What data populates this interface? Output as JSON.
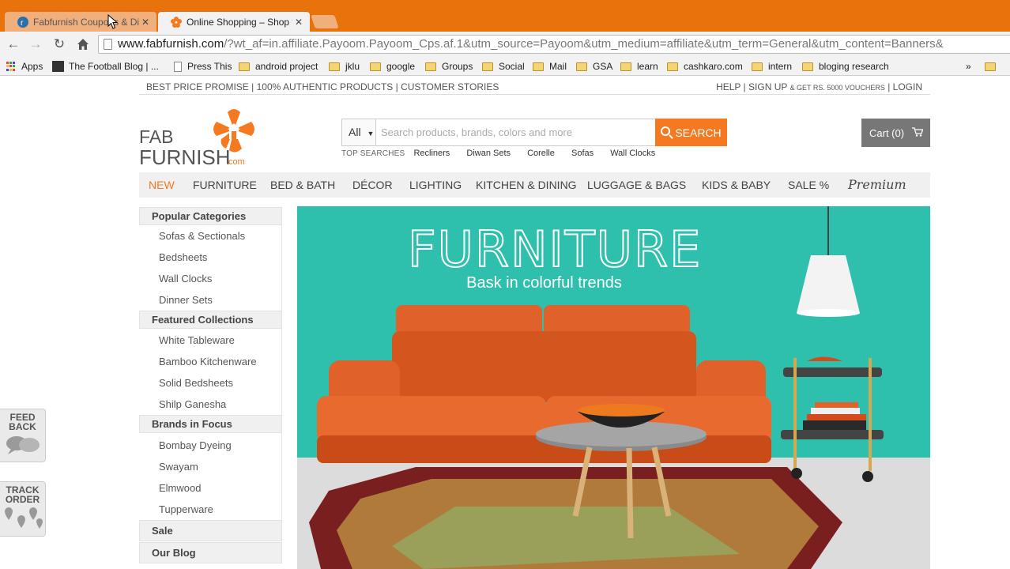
{
  "browser": {
    "tabs": [
      {
        "title": "Fabfurnish Coupons & Discount",
        "active": false
      },
      {
        "title": "Online Shopping – Shop for",
        "active": true
      }
    ],
    "url_host": "www.fabfurnish.com",
    "url_path": "/?wt_af=in.affiliate.Payoom.Payoom_Cps.af.1&utm_source=Payoom&utm_medium=affiliate&utm_term=General&utm_content=Banners&",
    "bookmarks": [
      "Apps",
      "The Football Blog | ...",
      "Press This",
      "android project",
      "jklu",
      "google",
      "Groups",
      "Social",
      "Mail",
      "GSA",
      "learn",
      "cashkaro.com",
      "intern",
      "bloging research"
    ],
    "overflow_label": "»"
  },
  "topbar": {
    "left": "BEST PRICE PROMISE  | 100% AUTHENTIC PRODUCTS | CUSTOMER STORIES",
    "help": "HELP",
    "signup": "SIGN UP",
    "voucher": "& GET RS. 5000 VOUCHERS",
    "login": "LOGIN"
  },
  "logo": {
    "line1": "FAB",
    "line2": "FURNISH",
    "suffix": ".com"
  },
  "search": {
    "category": "All",
    "placeholder": "Search products, brands, colors and more",
    "button": "SEARCH",
    "top_label": "TOP SEARCHES",
    "top_items": [
      "Recliners",
      "Diwan Sets",
      "Corelle",
      "Sofas",
      "Wall Clocks"
    ]
  },
  "cart": {
    "label": "Cart (0)"
  },
  "nav": [
    "NEW",
    "FURNITURE",
    "BED & BATH",
    "DÉCOR",
    "LIGHTING",
    "KITCHEN & DINING",
    "LUGGAGE & BAGS",
    "KIDS & BABY",
    "SALE %",
    "Premium"
  ],
  "sidebar": {
    "sections": [
      {
        "title": "Popular Categories",
        "items": [
          "Sofas & Sectionals",
          "Bedsheets",
          "Wall Clocks",
          "Dinner Sets"
        ]
      },
      {
        "title": "Featured Collections",
        "items": [
          "White Tableware",
          "Bamboo Kitchenware",
          "Solid Bedsheets",
          "Shilp Ganesha"
        ]
      },
      {
        "title": "Brands in Focus",
        "items": [
          "Bombay Dyeing",
          "Swayam",
          "Elmwood",
          "Tupperware"
        ]
      },
      {
        "title": "Sale",
        "items": []
      },
      {
        "title": "Our Blog",
        "items": []
      }
    ]
  },
  "banner": {
    "title": "FURNITURE",
    "subtitle": "Bask in colorful trends"
  },
  "floating": {
    "feedback": [
      "FEED",
      "BACK"
    ],
    "track": [
      "TRACK",
      "ORDER"
    ]
  },
  "colors": {
    "brand_orange": "#f47920",
    "banner_teal": "#2fbfad",
    "chrome_orange": "#e8720c"
  }
}
